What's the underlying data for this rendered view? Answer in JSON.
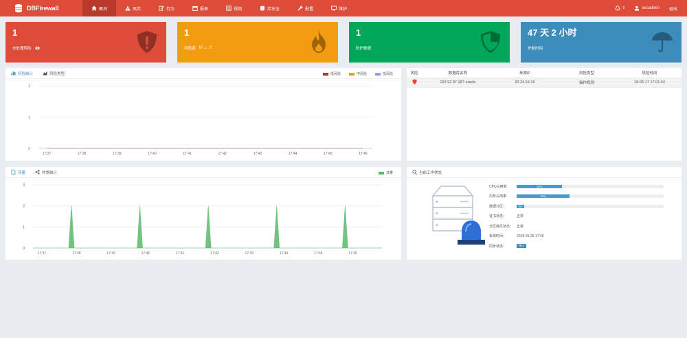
{
  "app": {
    "name": "DBFirewall"
  },
  "nav": [
    {
      "label": "概况",
      "icon": "home-icon",
      "active": true
    },
    {
      "label": "风险",
      "icon": "warning-icon"
    },
    {
      "label": "行为",
      "icon": "edit-icon"
    },
    {
      "label": "报表",
      "icon": "calendar-icon"
    },
    {
      "label": "规则",
      "icon": "list-icon"
    },
    {
      "label": "库安全",
      "icon": "database-icon"
    },
    {
      "label": "配置",
      "icon": "wrench-icon"
    },
    {
      "label": "维护",
      "icon": "monitor-icon"
    }
  ],
  "header_right": {
    "bell_count": "0",
    "user": "secadmin",
    "logout": "退出"
  },
  "stats": [
    {
      "value": "1",
      "label": "未处理风险",
      "extra": "",
      "color": "#dd4b39",
      "icon": "shield-alert-icon"
    },
    {
      "value": "1",
      "label": "风险源",
      "extra": "IP  ⊥  ⤮",
      "color": "#f39c12",
      "icon": "fire-icon"
    },
    {
      "value": "1",
      "label": "防护数据",
      "extra": "",
      "color": "#00a65a",
      "icon": "shield-icon"
    },
    {
      "value": "47 天 2 小时",
      "label": "护航时间",
      "extra": "",
      "color": "#3c8dbc",
      "icon": "umbrella-icon"
    }
  ],
  "risk_panel": {
    "tabs": [
      "风险统计",
      "风险类型"
    ],
    "legend": [
      {
        "name": "低风险",
        "color": "#c9302c"
      },
      {
        "name": "中风险",
        "color": "#f39c12"
      },
      {
        "name": "低风险",
        "color": "#8c9eff"
      }
    ]
  },
  "risk_chart": {
    "chart_data": {
      "type": "line",
      "x": [
        "17:37",
        "17:38",
        "17:39",
        "17:40",
        "17:41",
        "17:42",
        "17:43",
        "17:44",
        "17:45",
        "17:46"
      ],
      "series": [
        {
          "name": "低风险",
          "values": [
            0,
            0,
            0,
            0,
            0,
            0,
            0,
            0,
            0,
            0
          ]
        },
        {
          "name": "中风险",
          "values": [
            0,
            0,
            0,
            0,
            0,
            0,
            0,
            0,
            0,
            0
          ]
        },
        {
          "name": "低风险",
          "values": [
            0,
            0,
            0,
            0,
            0,
            0,
            0,
            0,
            0,
            0
          ]
        }
      ],
      "yticks": [
        "2",
        "1",
        "0"
      ],
      "ylim": [
        0,
        2
      ]
    }
  },
  "risk_table": {
    "headers": [
      "风险",
      "数据库名称",
      "来源IP",
      "风险类型",
      "风险时间"
    ],
    "rows": [
      {
        "level_icon": "shield-red-icon",
        "db": "192.92.97.187-oracle",
        "ip": "60.24.64.19",
        "type": "操作规则",
        "time": "18-05-17 17:01:44"
      }
    ]
  },
  "traffic_panel": {
    "tabs": [
      "流量",
      "并发统计"
    ],
    "legend": [
      {
        "name": "流量",
        "color": "#59b96b"
      }
    ]
  },
  "traffic_chart": {
    "chart_data": {
      "type": "area",
      "x": [
        "17:37",
        "17:38",
        "17:39",
        "17:40",
        "17:41",
        "17:42",
        "17:43",
        "17:44",
        "17:45",
        "17:46"
      ],
      "series": [
        {
          "name": "流量",
          "values": [
            0,
            0,
            2,
            0,
            2,
            0,
            2,
            0,
            2,
            0,
            2,
            0
          ]
        }
      ],
      "yticks": [
        "3",
        "2",
        "1",
        "0"
      ],
      "ylim": [
        0,
        3
      ]
    }
  },
  "status_panel": {
    "title": "当前工作状态",
    "rows": [
      {
        "key": "CPU占用率:",
        "type": "bar",
        "value": 31,
        "text": "31%"
      },
      {
        "key": "内存占用率:",
        "type": "bar",
        "value": 36,
        "text": "36%"
      },
      {
        "key": "数据分区:",
        "type": "bar",
        "value": 4,
        "text": "4%"
      },
      {
        "key": "证书状态:",
        "type": "text",
        "text": "正常"
      },
      {
        "key": "分区拷贝状态:",
        "type": "text",
        "text": "正常"
      },
      {
        "key": "系统时间:",
        "type": "text",
        "text": "2018-06-26 17:46"
      },
      {
        "key": "同步状态:",
        "type": "badge",
        "text": "停止"
      }
    ]
  }
}
